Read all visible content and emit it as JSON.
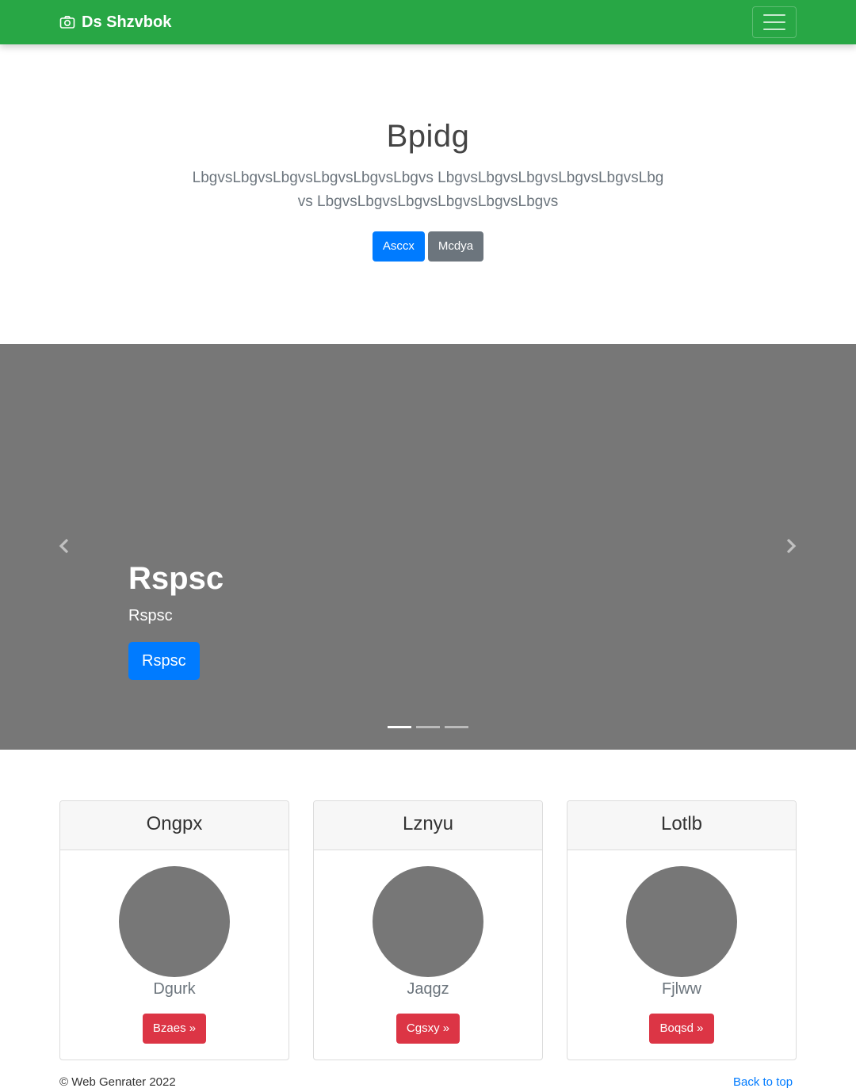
{
  "navbar": {
    "brand": "Ds Shzvbok",
    "brand_icon": "camera-icon",
    "toggler_icon": "hamburger-icon",
    "bg_color": "#28a745"
  },
  "hero": {
    "title": "Bpidg",
    "lead": "LbgvsLbgvsLbgvsLbgvsLbgvsLbgvs LbgvsLbgvsLbgvsLbgvsLbgvsLbgvs LbgvsLbgvsLbgvsLbgvsLbgvsLbgvs",
    "primary_button": "Asccx",
    "secondary_button": "Mcdya"
  },
  "carousel": {
    "caption_title": "Rspsc",
    "caption_text": "Rspsc",
    "caption_button": "Rspsc",
    "prev_icon": "chevron-left-icon",
    "next_icon": "chevron-right-icon",
    "slide_count": 3,
    "active_slide": 1,
    "bg_color": "#777777"
  },
  "cards": [
    {
      "header": "Ongpx",
      "name": "Dgurk",
      "button": "Bzaes »"
    },
    {
      "header": "Lznyu",
      "name": "Jaqgz",
      "button": "Cgsxy »"
    },
    {
      "header": "Lotlb",
      "name": "Fjlww",
      "button": "Boqsd »"
    }
  ],
  "footer": {
    "copyright": "© Web Genrater 2022",
    "back_to_top": "Back to top"
  }
}
